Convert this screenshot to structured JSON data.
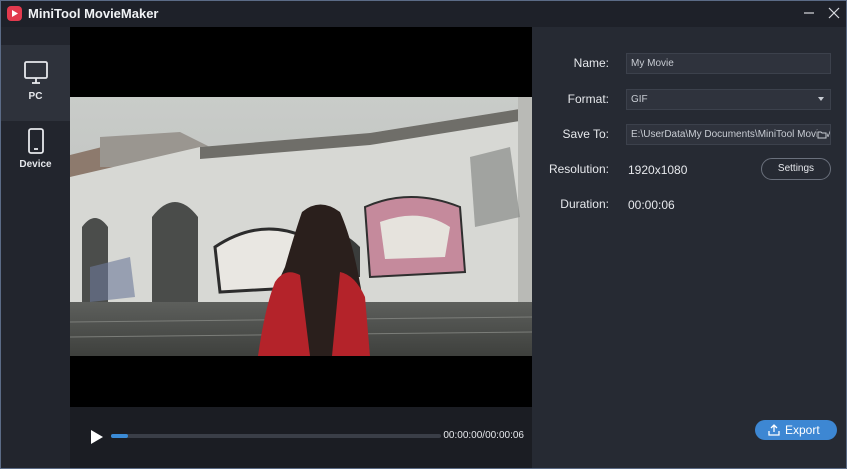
{
  "window": {
    "title": "MiniTool MovieMaker",
    "brand_color": "#e23a4e"
  },
  "sidebar": {
    "items": [
      {
        "label": "PC",
        "icon": "monitor-icon",
        "active": true
      },
      {
        "label": "Device",
        "icon": "phone-icon",
        "active": false
      }
    ]
  },
  "player": {
    "time": "00:00:00/00:00:06",
    "progress": 0.05,
    "accent": "#3b8bd6"
  },
  "export_form": {
    "name_label": "Name:",
    "name_value": "My Movie",
    "format_label": "Format:",
    "format_value": "GIF",
    "save_to_label": "Save To:",
    "save_to_value": "E:\\UserData\\My Documents\\MiniTool MovieMaker",
    "resolution_label": "Resolution:",
    "resolution_value": "1920x1080",
    "settings_label": "Settings",
    "duration_label": "Duration:",
    "duration_value": "00:00:06",
    "export_label": "Export",
    "export_color": "#3d87d3"
  }
}
